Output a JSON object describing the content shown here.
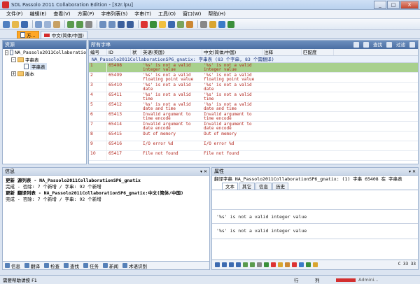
{
  "window": {
    "title": "SDL Passolo 2011 Collaboration Edition - [32r.lpu]",
    "btn_min": "_",
    "btn_max": "□",
    "btn_close": "X"
  },
  "menu": [
    "文件(F)",
    "编辑(E)",
    "查看(V)",
    "方案(P)",
    "字串列表(S)",
    "字串(T)",
    "工具(O)",
    "窗口(W)",
    "帮助(H)"
  ],
  "tabs": {
    "tab1": "方...",
    "tab2": "中文(简体/中国)"
  },
  "resources": {
    "header": "资源",
    "project": "NA_Passolo2011Collaboratio",
    "string_table": "字串表",
    "string_table_child": "字串表",
    "version": "版本"
  },
  "grid": {
    "header": "所有字串",
    "find_label": "查找",
    "filter_label": "过滤",
    "columns": [
      "编号",
      "ID",
      "状",
      "英语(美国)",
      "中文(简体/中国)",
      "注释",
      "匹配度"
    ],
    "group": "NA_Passolo2011CollaborationSP6_gnatix: 字串表 (83 个字串, 83 个需翻译)",
    "rows": [
      {
        "num": "1",
        "id": "65408",
        "src": "'%s' is not a valid integer value",
        "tgt": "'%s' is not a valid integer value",
        "selected": true
      },
      {
        "num": "2",
        "id": "65409",
        "src": "'%s' is not a valid floating point value",
        "tgt": "'%s' is not a valid floating point value",
        "selected": false
      },
      {
        "num": "3",
        "id": "65410",
        "src": "'%s' is not a valid date",
        "tgt": "'%s' is not a valid date",
        "selected": false
      },
      {
        "num": "4",
        "id": "65411",
        "src": "'%s' is not a valid time",
        "tgt": "'%s' is not a valid time",
        "selected": false
      },
      {
        "num": "5",
        "id": "65412",
        "src": "'%s' is not a valid date and time",
        "tgt": "'%s' is not a valid date and time",
        "selected": false
      },
      {
        "num": "6",
        "id": "65413",
        "src": "Invalid argument to time encode",
        "tgt": "Invalid argument to time encode",
        "selected": false
      },
      {
        "num": "7",
        "id": "65414",
        "src": "Invalid argument to date encode",
        "tgt": "Invalid argument to date encode",
        "selected": false
      },
      {
        "num": "8",
        "id": "65415",
        "src": "Out of memory",
        "tgt": "Out of memory",
        "selected": false
      },
      {
        "num": "9",
        "id": "65416",
        "src": "I/O error %d",
        "tgt": "I/O error %d",
        "selected": false
      },
      {
        "num": "10",
        "id": "65417",
        "src": "File not found",
        "tgt": "File not found",
        "selected": false
      }
    ]
  },
  "info": {
    "header": "信息",
    "lines": [
      {
        "text": "更新 源列表 - NA_Passolo2011CollaborationSP6_gnatix",
        "bold": true
      },
      {
        "text": "完成 - 否除: 7 个新增 / 字串: 92 个新增",
        "bold": false
      },
      {
        "text": "更新 翻译列表 - NA_Passolo2011CollaborationSP6_gnatix:中文(简体/中国)",
        "bold": true
      },
      {
        "text": "完成 - 否除: 7 个新增 / 字串: 92 个新增",
        "bold": false
      }
    ],
    "tabs": [
      "信息",
      "翻译",
      "检查",
      "查找",
      "任务",
      "新闻",
      "术语识别"
    ]
  },
  "props": {
    "header": "属性",
    "title": "翻译字串 NA_Passolo2011CollaborationSP6_gnatix: (1) 字串 65408 在 字串表",
    "tabs": [
      "文本",
      "其它",
      "信息",
      "历史"
    ],
    "source_text": "'%s' is not a valid integer value",
    "target_text": "'%s' is not a valid integer value",
    "counts": "C 33 33"
  },
  "status": {
    "help": "需要帮助请按 F1",
    "line": "行",
    "col": "列",
    "user": "Admini..."
  },
  "colors": {
    "accent": "#4b6fa3",
    "selected_row": "#a8d08d",
    "text_red": "#b0231b"
  }
}
